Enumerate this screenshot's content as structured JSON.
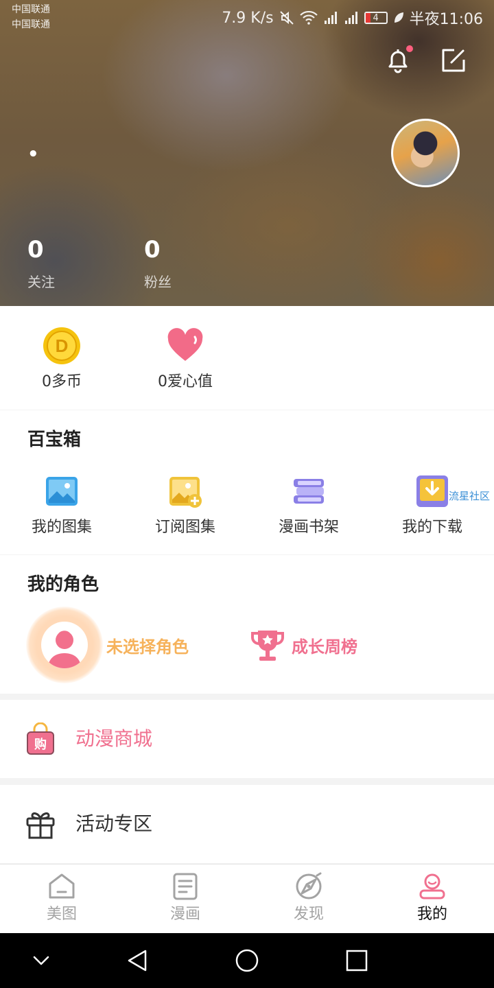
{
  "status_bar": {
    "carrier1": "中国联通",
    "carrier2": "中国联通",
    "net_speed": "7.9 K/s",
    "battery": "4",
    "time": "半夜11:06"
  },
  "profile": {
    "nickname": "•",
    "following_count": "0",
    "following_label": "关注",
    "fans_count": "0",
    "fans_label": "粉丝"
  },
  "wallet": {
    "coins": "0多币",
    "hearts": "0爱心值"
  },
  "toolbox": {
    "title": "百宝箱",
    "items": [
      {
        "label": "我的图集",
        "icon": "gallery-icon"
      },
      {
        "label": "订阅图集",
        "icon": "subscribe-gallery-icon"
      },
      {
        "label": "漫画书架",
        "icon": "bookshelf-icon"
      },
      {
        "label": "我的下载",
        "icon": "download-icon"
      }
    ],
    "badge": "流星社区"
  },
  "roles": {
    "title": "我的角色",
    "no_role": "未选择角色",
    "growth_rank": "成长周榜"
  },
  "menu": {
    "shop": "动漫商城",
    "activity": "活动专区"
  },
  "tabs": [
    {
      "label": "美图",
      "icon": "home-icon"
    },
    {
      "label": "漫画",
      "icon": "comic-icon"
    },
    {
      "label": "发现",
      "icon": "discover-icon"
    },
    {
      "label": "我的",
      "icon": "profile-icon"
    }
  ],
  "colors": {
    "accent_pink": "#f0708f",
    "role_orange": "#f6b25b",
    "notification_dot": "#ff5f7f"
  }
}
